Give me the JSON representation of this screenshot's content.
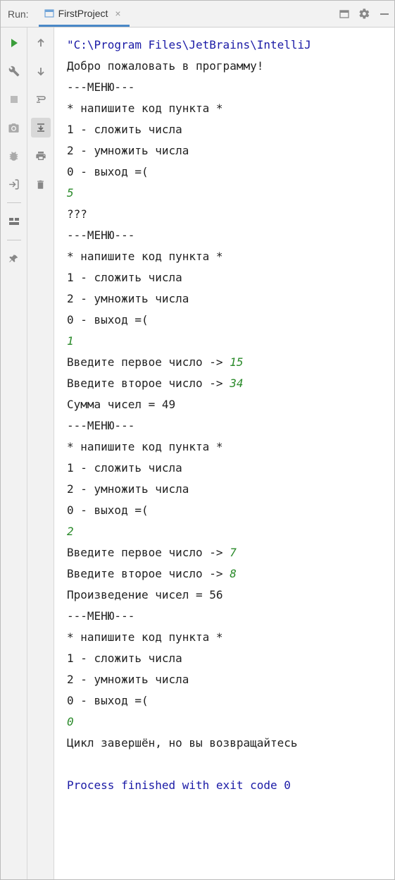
{
  "header": {
    "run_label": "Run:",
    "tab_label": "FirstProject",
    "close_glyph": "×"
  },
  "left_tools": {
    "run": "run-icon",
    "wrench": "wrench-icon",
    "stop": "stop-icon",
    "camera": "camera-icon",
    "bug": "bug-icon",
    "exit": "exit-icon",
    "layout": "layout-icon",
    "pin": "pin-icon"
  },
  "mid_tools": {
    "up": "arrow-up-icon",
    "down": "arrow-down-icon",
    "wrap": "soft-wrap-icon",
    "scroll": "scroll-to-end-icon",
    "print": "print-icon",
    "trash": "trash-icon"
  },
  "console": {
    "cmd": "\"C:\\Program Files\\JetBrains\\IntelliJ",
    "welcome": "Добро пожаловать в программу!",
    "menu_header": "---МЕНЮ---",
    "prompt_code": "* напишите код пункта *",
    "opt1": "1 - сложить числа",
    "opt2": "2 - умножить числа",
    "opt0": "0 - выход =(",
    "in5": "5",
    "unknown": "???",
    "in1": "1",
    "enter_first": "Введите первое число -> ",
    "enter_second": "Введите второе число -> ",
    "v15": "15",
    "v34": "34",
    "sum49": "Сумма чисел = 49",
    "in2": "2",
    "v7": "7",
    "v8": "8",
    "prod56": "Произведение чисел = 56",
    "in0": "0",
    "goodbye": "Цикл завершён, но вы возвращайтесь",
    "exit": "Process finished with exit code 0"
  }
}
